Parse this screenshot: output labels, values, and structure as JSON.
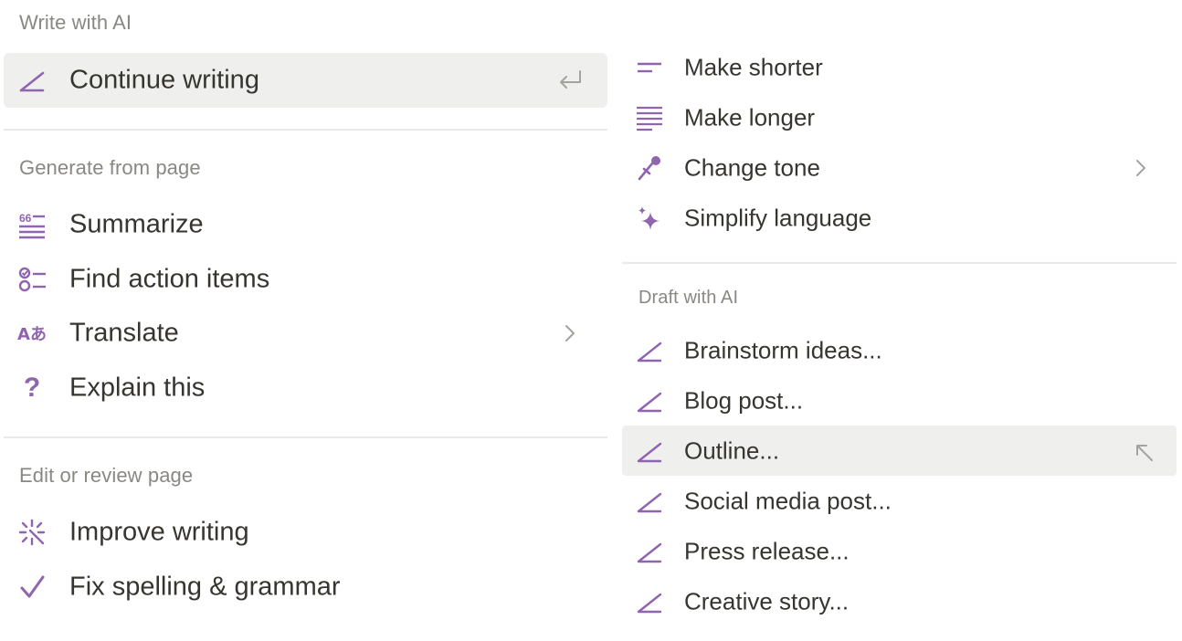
{
  "accent_color": "#9065b0",
  "left": {
    "write_header": "Write with AI",
    "continue_writing": {
      "label": "Continue writing",
      "icon": "pen-icon",
      "shortcut_icon": "return-key-icon"
    },
    "generate_header": "Generate from page",
    "generate_items": [
      {
        "label": "Summarize",
        "icon": "summarize-icon"
      },
      {
        "label": "Find action items",
        "icon": "action-items-icon"
      },
      {
        "label": "Translate",
        "icon": "translate-icon",
        "has_submenu": true
      },
      {
        "label": "Explain this",
        "icon": "question-mark-icon"
      }
    ],
    "translate_icon_text": "Aあ",
    "explain_icon_text": "?",
    "edit_header": "Edit or review page",
    "edit_items": [
      {
        "label": "Improve writing",
        "icon": "sparkle-burst-icon"
      },
      {
        "label": "Fix spelling & grammar",
        "icon": "checkmark-icon"
      }
    ]
  },
  "right": {
    "edit_items": [
      {
        "label": "Make shorter",
        "icon": "short-lines-icon"
      },
      {
        "label": "Make longer",
        "icon": "long-lines-icon"
      },
      {
        "label": "Change tone",
        "icon": "microphone-icon",
        "has_submenu": true
      },
      {
        "label": "Simplify language",
        "icon": "sparkles-icon"
      }
    ],
    "draft_header": "Draft with AI",
    "draft_items": [
      {
        "label": "Brainstorm ideas...",
        "icon": "pen-icon"
      },
      {
        "label": "Blog post...",
        "icon": "pen-icon"
      },
      {
        "label": "Outline...",
        "icon": "pen-icon",
        "active": true
      },
      {
        "label": "Social media post...",
        "icon": "pen-icon"
      },
      {
        "label": "Press release...",
        "icon": "pen-icon"
      },
      {
        "label": "Creative story...",
        "icon": "pen-icon"
      }
    ]
  }
}
